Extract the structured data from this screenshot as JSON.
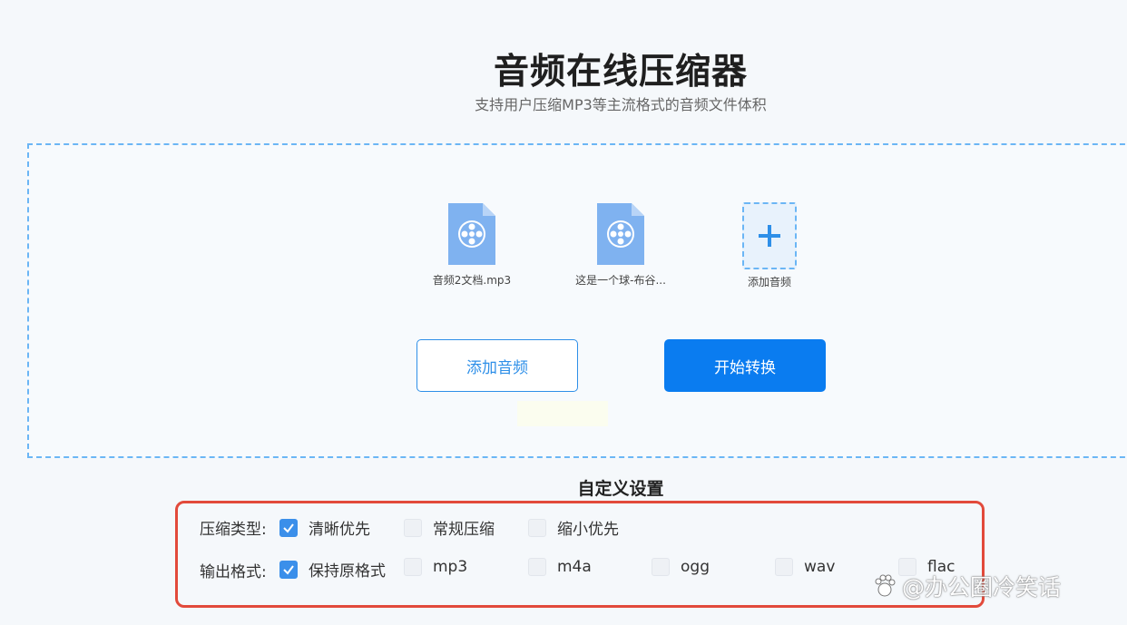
{
  "page": {
    "title": "音频在线压缩器",
    "subtitle": "支持用户压缩MP3等主流格式的音频文件体积"
  },
  "files": [
    {
      "name": "音频2文档.mp3",
      "icon": "audio-file-icon"
    },
    {
      "name": "这是一个球-布谷...",
      "icon": "audio-file-icon"
    }
  ],
  "add_tile": {
    "label": "添加音频",
    "icon": "plus-icon"
  },
  "buttons": {
    "add_audio": "添加音频",
    "start_convert": "开始转换"
  },
  "settings": {
    "title": "自定义设置",
    "compression": {
      "label": "压缩类型:",
      "options": [
        {
          "label": "清晰优先",
          "checked": true
        },
        {
          "label": "常规压缩",
          "checked": false
        },
        {
          "label": "缩小优先",
          "checked": false
        }
      ]
    },
    "output": {
      "label": "输出格式:",
      "options": [
        {
          "label": "保持原格式",
          "checked": true
        },
        {
          "label": "mp3",
          "checked": false
        },
        {
          "label": "m4a",
          "checked": false
        },
        {
          "label": "ogg",
          "checked": false
        },
        {
          "label": "wav",
          "checked": false
        },
        {
          "label": "flac",
          "checked": false
        }
      ]
    }
  },
  "watermark": "@办公圈冷笑话",
  "colors": {
    "accent": "#0a7cf0",
    "highlight_border": "#e24a3b",
    "checkbox_checked": "#3b8fea"
  }
}
